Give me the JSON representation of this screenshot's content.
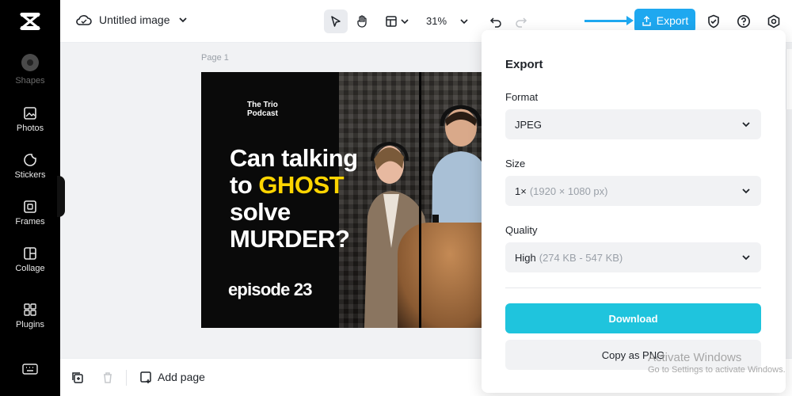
{
  "app": {
    "doc_title": "Untitled image",
    "zoom": "31%"
  },
  "toolbar": {
    "export_label": "Export"
  },
  "sidebar": {
    "items": [
      {
        "label": "Shapes",
        "icon": "shapes-icon"
      },
      {
        "label": "Photos",
        "icon": "photos-icon"
      },
      {
        "label": "Stickers",
        "icon": "stickers-icon"
      },
      {
        "label": "Frames",
        "icon": "frames-icon"
      },
      {
        "label": "Collage",
        "icon": "collage-icon"
      },
      {
        "label": "Plugins",
        "icon": "plugins-icon"
      }
    ]
  },
  "canvas": {
    "page_label": "Page 1",
    "podcast_line1": "The Trio",
    "podcast_line2": "Podcast",
    "headline_line1": "Can talking",
    "headline_line2_pre": "to ",
    "headline_highlight": "GHOST",
    "headline_line3": "solve",
    "headline_line4": "MURDER?",
    "episode": "episode 23",
    "highlight_color": "#ffd500"
  },
  "bottom": {
    "add_page_label": "Add page"
  },
  "export_panel": {
    "title": "Export",
    "format_label": "Format",
    "format_value": "JPEG",
    "size_label": "Size",
    "size_value": "1×",
    "size_detail": "(1920 × 1080 px)",
    "quality_label": "Quality",
    "quality_value": "High",
    "quality_detail": "(274 KB - 547 KB)",
    "download_label": "Download",
    "copy_label": "Copy as PNG",
    "accent_color": "#1fc4dd"
  },
  "watermark": {
    "line1": "Activate Windows",
    "line2": "Go to Settings to activate Windows."
  }
}
